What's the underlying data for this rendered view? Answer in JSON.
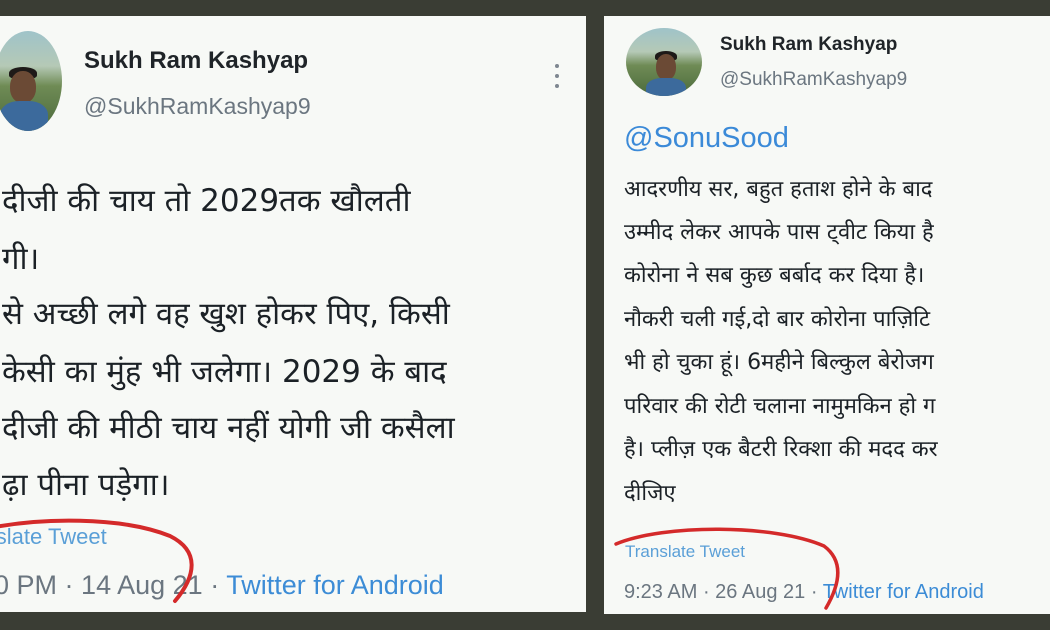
{
  "left_tweet": {
    "author_name": "Sukh Ram Kashyap",
    "handle": "@SukhRamKashyap9",
    "text_lines": [
      "दीजी की चाय तो 2029तक खौलती",
      "गी।",
      "से अच्छी लगे वह खुश होकर पिए, किसी",
      "केसी का मुंह भी जलेगा। 2029 के बाद",
      "दीजी की मीठी चाय नहीं योगी जी कसैला",
      "ढ़ा पीना पड़ेगा।"
    ],
    "translate_label": "ranslate Tweet",
    "time": "0 PM",
    "date": "14 Aug 21",
    "source": "Twitter for Android",
    "more_icon": "more-vertical-icon"
  },
  "right_tweet": {
    "author_name": "Sukh Ram Kashyap",
    "handle": "@SukhRamKashyap9",
    "mention": "@SonuSood",
    "text_lines": [
      "आदरणीय सर, बहुत हताश होने के बाद",
      "उम्मीद लेकर आपके पास ट्वीट किया है",
      "कोरोना ने सब कुछ बर्बाद कर दिया है।",
      "नौकरी चली गई,दो बार कोरोना पाज़िटि",
      "भी हो चुका हूं। 6महीने बिल्कुल बेरोजग",
      "परिवार की रोटी चलाना नामुमकिन हो ग",
      "है। प्लीज़ एक बैटरी रिक्शा की मदद कर",
      "दीजिए"
    ],
    "translate_label": "Translate Tweet",
    "time": "9:23 AM",
    "date": "26 Aug 21",
    "source": "Twitter for Android"
  },
  "colors": {
    "background": "#3a3d34",
    "card": "#f7f9f6",
    "link": "#3c8cd6",
    "annotation": "#d42a2a"
  }
}
